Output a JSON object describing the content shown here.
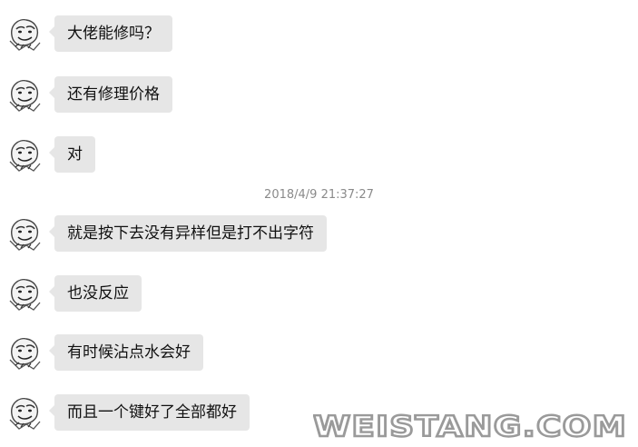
{
  "chat": {
    "messages": [
      {
        "text": "大佬能修吗？"
      },
      {
        "text": "还有修理价格"
      },
      {
        "text": "对"
      },
      {
        "text": "就是按下去没有异样但是打不出字符"
      },
      {
        "text": "也没反应"
      },
      {
        "text": "有时候沾点水会好"
      },
      {
        "text": "而且一个键好了全部都好"
      }
    ],
    "timestamp": "2018/4/9 21:37:27"
  },
  "watermark": {
    "text": "WEISTANG.COM"
  },
  "colors": {
    "bubble": "#e6e6e6",
    "timestamp": "#8a8a8a",
    "watermark": "#9a9a9a"
  }
}
